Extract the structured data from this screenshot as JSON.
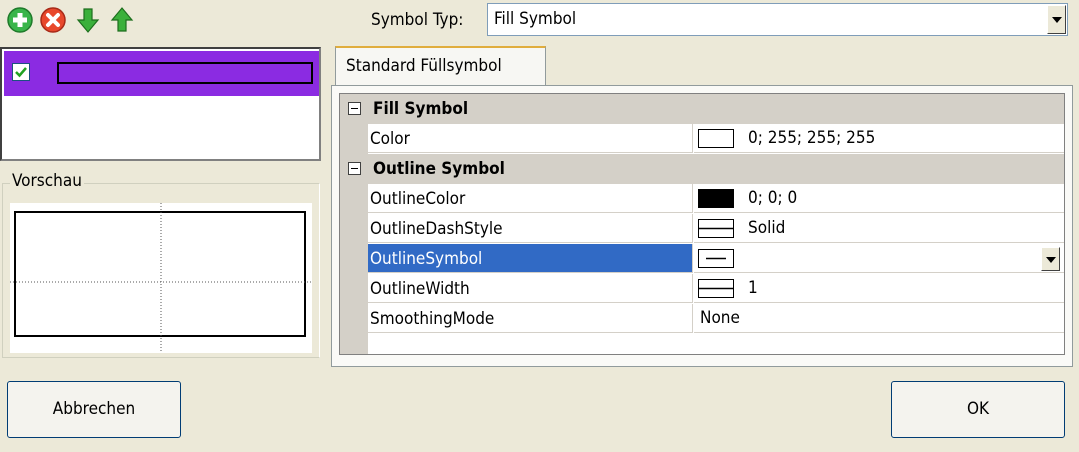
{
  "toolbar": {
    "icons": [
      "add-icon",
      "remove-icon",
      "move-down-icon",
      "move-up-icon"
    ],
    "colors": {
      "add": "#2fa82f",
      "remove": "#e23c28",
      "arrow": "#2e9a2e"
    }
  },
  "layers": {
    "items": [
      {
        "checked": true,
        "color": "#8b2be2"
      }
    ]
  },
  "preview": {
    "legend": "Vorschau"
  },
  "symbol_type": {
    "label": "Symbol Typ:",
    "value": "Fill Symbol"
  },
  "tabs": [
    {
      "label": "Standard Füllsymbol",
      "active": true
    }
  ],
  "property_grid": {
    "categories": [
      {
        "name": "Fill Symbol",
        "properties": [
          {
            "name": "Color",
            "value": "0; 255; 255; 255",
            "swatch": "#ffffff"
          }
        ]
      },
      {
        "name": "Outline Symbol",
        "properties": [
          {
            "name": "OutlineColor",
            "value": "0; 0; 0",
            "swatch": "#000000"
          },
          {
            "name": "OutlineDashStyle",
            "value": "Solid",
            "icon": "solid-line-icon"
          },
          {
            "name": "OutlineSymbol",
            "value": "",
            "icon": "line-symbol-icon",
            "selected": true
          },
          {
            "name": "OutlineWidth",
            "value": "1",
            "icon": "line-width-icon"
          },
          {
            "name": "SmoothingMode",
            "value": "None"
          }
        ]
      }
    ]
  },
  "buttons": {
    "cancel": "Abbrechen",
    "ok": "OK"
  },
  "colors": {
    "selection": "#316ac5",
    "layer_fill": "#8b2be2",
    "window": "#ece9d8"
  }
}
